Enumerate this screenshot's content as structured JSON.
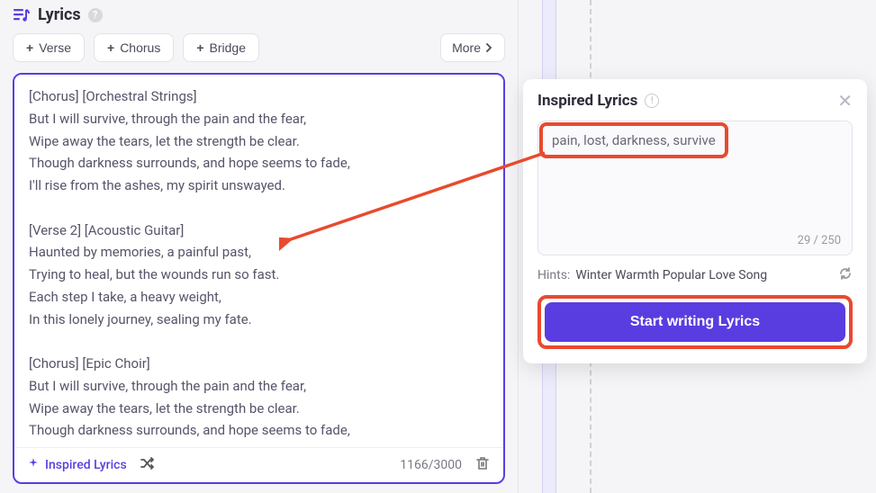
{
  "header": {
    "title": "Lyrics"
  },
  "toolbar": {
    "verse_label": "Verse",
    "chorus_label": "Chorus",
    "bridge_label": "Bridge",
    "more_label": "More"
  },
  "editor": {
    "content": "[Chorus] [Orchestral Strings]\nBut I will survive, through the pain and the fear,\nWipe away the tears, let the strength be clear.\nThough darkness surrounds, and hope seems to fade,\nI'll rise from the ashes, my spirit unswayed.\n\n[Verse 2] [Acoustic Guitar]\nHaunted by memories, a painful past,\nTrying to heal, but the wounds run so fast.\nEach step I take, a heavy weight,\nIn this lonely journey, sealing my fate.\n\n[Chorus] [Epic Choir]\nBut I will survive, through the pain and the fear,\nWipe away the tears, let the strength be clear.\nThough darkness surrounds, and hope seems to fade,",
    "char_count": "1166/3000",
    "inspired_label": "Inspired Lyrics"
  },
  "panel": {
    "title": "Inspired Lyrics",
    "prompt_value": "pain, lost, darkness, survive",
    "prompt_count": "29 / 250",
    "hints_label": "Hints:",
    "hints_text": "Winter Warmth Popular Love Song",
    "cta_label": "Start writing Lyrics"
  }
}
